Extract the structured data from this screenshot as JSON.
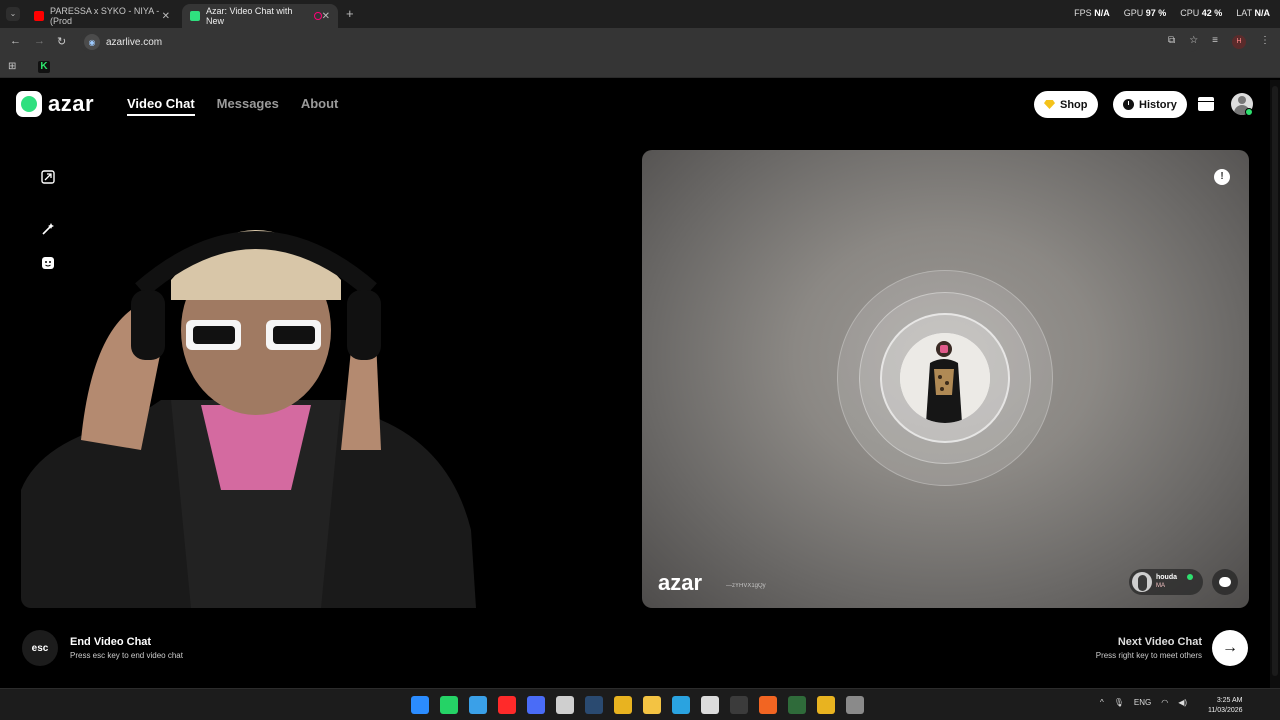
{
  "browser": {
    "tabs": [
      {
        "title": "PARESSA x SYKO - NIYA - (Prod",
        "active": false,
        "favicon_color": "#ff0000"
      },
      {
        "title": "Azar: Video Chat with New",
        "active": true,
        "favicon_color": "#2fe07f"
      }
    ],
    "stats": {
      "fps_label": "FPS",
      "fps_value": "N/A",
      "gpu_label": "GPU",
      "gpu_value": "97 %",
      "cpu_label": "CPU",
      "cpu_value": "42 %",
      "lat_label": "LAT",
      "lat_value": "N/A"
    },
    "url": "azarlive.com",
    "profile_initial": "H"
  },
  "app": {
    "logo_text": "azar",
    "nav": [
      {
        "label": "Video Chat",
        "active": true
      },
      {
        "label": "Messages",
        "active": false
      },
      {
        "label": "About",
        "active": false
      }
    ],
    "shop_label": "Shop",
    "history_label": "History",
    "watermark": "azar",
    "watermark_id": "—zYHVX1gQy",
    "peer": {
      "name": "houda",
      "country": "MA"
    },
    "report_glyph": "!",
    "end": {
      "key": "esc",
      "title": "End Video Chat",
      "subtitle": "Press esc key to end video chat"
    },
    "next": {
      "title": "Next Video Chat",
      "subtitle": "Press right key to meet others",
      "glyph": "→"
    }
  },
  "taskbar": {
    "icons": [
      {
        "name": "windows-start-icon",
        "color": "#2b8cff"
      },
      {
        "name": "whatsapp-icon",
        "color": "#25d366"
      },
      {
        "name": "file-icon",
        "color": "#3aa0e8"
      },
      {
        "name": "youtube-icon",
        "color": "#ff2a2a"
      },
      {
        "name": "app-blue-icon",
        "color": "#4a6cf7"
      },
      {
        "name": "check-icon",
        "color": "#cfcfcf"
      },
      {
        "name": "steam-icon",
        "color": "#2a4a70"
      },
      {
        "name": "chrome-icon",
        "color": "#e8b320"
      },
      {
        "name": "folder-icon",
        "color": "#f3c343"
      },
      {
        "name": "telegram-icon",
        "color": "#2aa3e0"
      },
      {
        "name": "store-icon",
        "color": "#dcdcdc"
      },
      {
        "name": "terminal-icon",
        "color": "#3b3b3b"
      },
      {
        "name": "origin-icon",
        "color": "#f26522"
      },
      {
        "name": "grid-app-icon",
        "color": "#2f6b3a"
      },
      {
        "name": "chrome-active-icon",
        "color": "#e8b320"
      },
      {
        "name": "chrome-alt-icon",
        "color": "#8a8a8a"
      }
    ],
    "lang": "ENG",
    "time": "3:25 AM",
    "date": "11/03/2026"
  }
}
